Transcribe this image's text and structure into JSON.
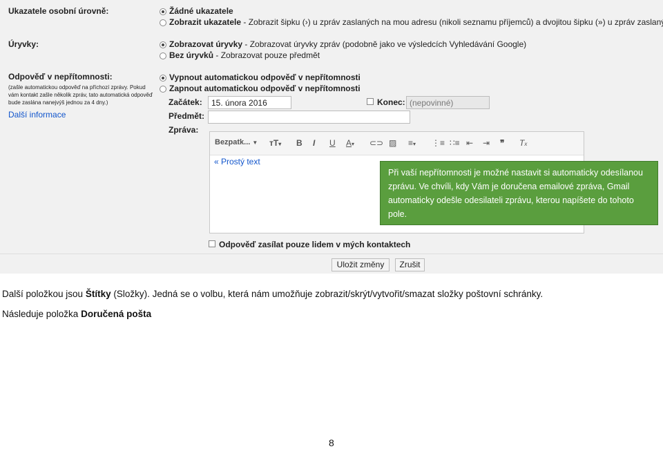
{
  "settings": {
    "indicators": {
      "label": "Ukazatele osobní úrovně:",
      "option_none_title": "Žádné ukazatele",
      "option_show_title": "Zobrazit ukazatele",
      "option_show_desc": " - Zobrazit šipku (›) u zpráv zaslaných na mou adresu (nikoli seznamu příjemců) a dvojitou šipku (») u zpráv zaslaných"
    },
    "snippets": {
      "label": "Úryvky:",
      "option_show_title": "Zobrazovat úryvky",
      "option_show_desc": " - Zobrazovat úryvky zpráv (podobně jako ve výsledcích Vyhledávání Google)",
      "option_hide_title": "Bez úryvků",
      "option_hide_desc": " - Zobrazovat pouze předmět"
    },
    "vacation": {
      "label": "Odpověď v nepřítomnosti:",
      "desc_line1": "(zašle automatickou odpověď na příchozí zprávy. Pokud",
      "desc_line2": "vám kontakt zašle několik zpráv, tato automatická odpověď",
      "desc_line3": "bude zaslána nanejvýš jednou za 4 dny.)",
      "more_info_link": "Další informace",
      "option_off": "Vypnout automatickou odpověď v nepřítomnosti",
      "option_on": "Zapnout automatickou odpověď v nepřítomnosti",
      "start_label": "Začátek:",
      "start_value": "15. února 2016",
      "end_label": "Konec:",
      "end_placeholder": "(nepovinné)",
      "subject_label": "Předmět:",
      "message_label": "Zpráva:",
      "font_select": "Bezpatk...",
      "plain_text_link": "« Prostý text",
      "contacts_only_label": "Odpověď zasílat pouze lidem v mých kontaktech"
    },
    "buttons": {
      "save": "Uložit změny",
      "cancel": "Zrušit"
    }
  },
  "callout": {
    "text": "Při vaší nepřítomnosti je možné nastavit si automaticky odesílanou zprávu. Ve chvíli, kdy Vám je doručena emailové zpráva, Gmail automaticky odešle odesilateli zprávu, kterou napíšete do tohoto pole."
  },
  "document": {
    "p1_pre": "Další položkou jsou ",
    "p1_bold": "Štítky",
    "p1_post": " (Složky). Jedná se o volbu, která nám umožňuje zobrazit/skrýt/vytvořit/smazat složky poštovní schránky.",
    "p2_pre": "Následuje položka ",
    "p2_bold": "Doručená pošta",
    "page_number": "8"
  },
  "colors": {
    "callout_bg": "#5a9e3e",
    "link": "#1155cc",
    "panel_bg": "#f1f1f1"
  }
}
